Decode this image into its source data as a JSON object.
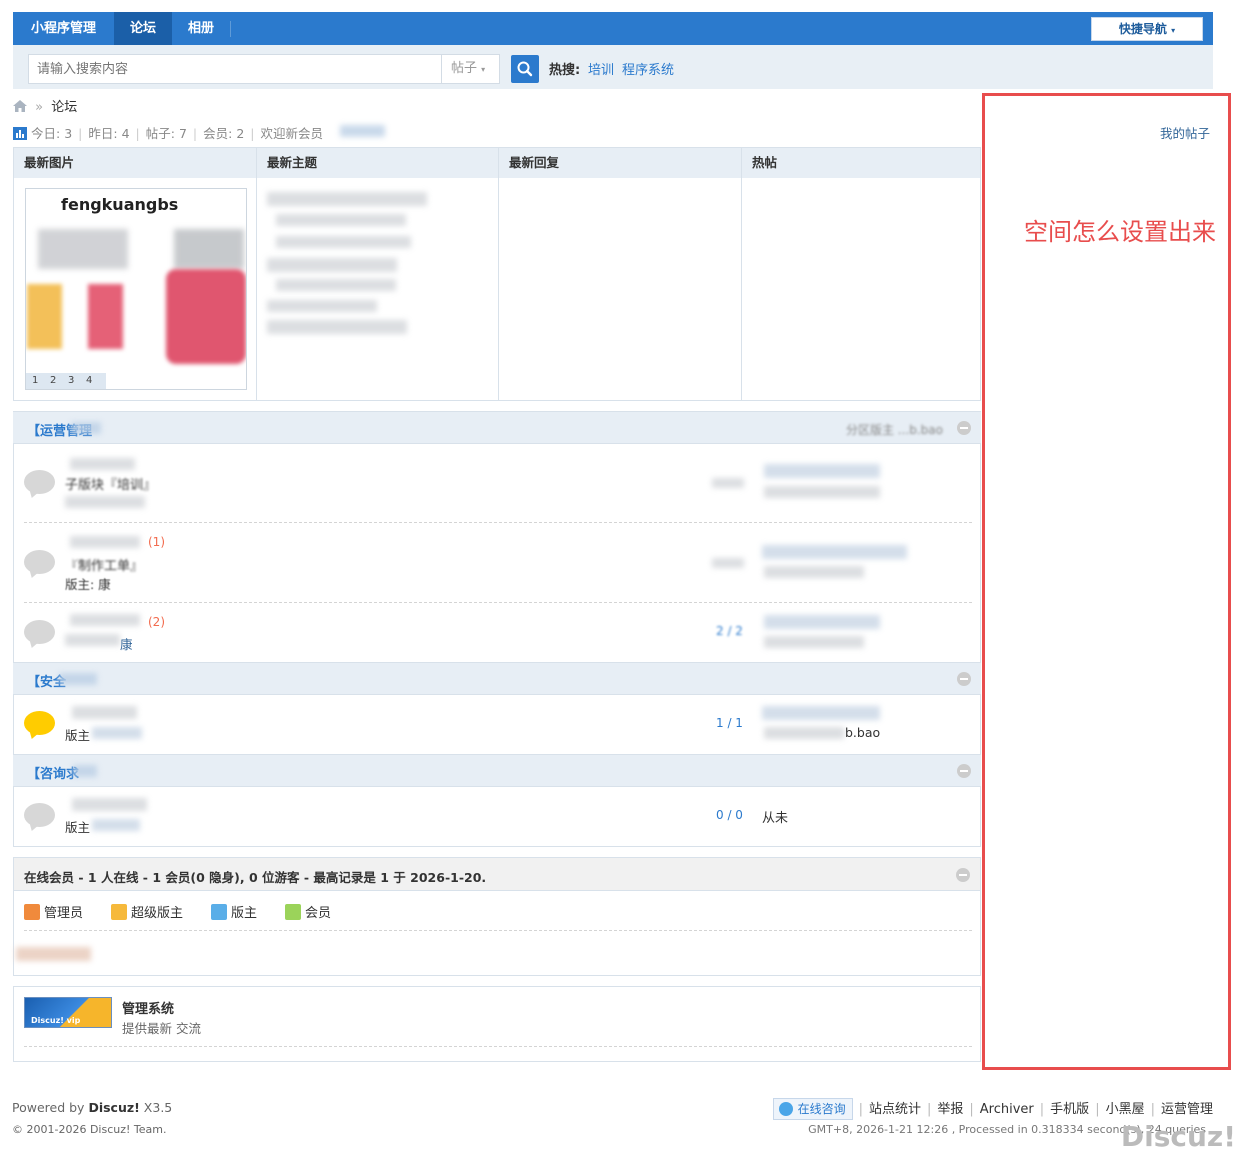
{
  "topnav": {
    "items": [
      "小程序管理",
      "论坛",
      "相册"
    ],
    "active_index": 1,
    "quick_nav": "快捷导航"
  },
  "search": {
    "placeholder": "请输入搜索内容",
    "type": "帖子",
    "hot_label": "热搜:",
    "hot_links": [
      "培训",
      "程序系统"
    ]
  },
  "breadcrumb": {
    "current": "论坛"
  },
  "stats": {
    "today_label": "今日:",
    "today": "3",
    "yesterday_label": "昨日:",
    "yesterday": "4",
    "posts_label": "帖子:",
    "posts": "7",
    "members_label": "会员:",
    "members": "2",
    "welcome_label": "欢迎新会员"
  },
  "highlights": {
    "headers": [
      "最新图片",
      "最新主题",
      "最新回复",
      "热帖"
    ],
    "image_title": "fengkuangbs",
    "slide_pages": [
      "1",
      "2",
      "3",
      "4"
    ]
  },
  "categories": [
    {
      "title": "【运营管理",
      "right_note": "分区版主 ...b.bao"
    },
    {
      "title": "【安全"
    },
    {
      "title": "【咨询求"
    }
  ],
  "forums": {
    "row1_name": "子版块『培训』",
    "row2_name": "『制作工单』",
    "row2_today": "(1)",
    "row2_mod": "版主: 康",
    "row3_today": "(2)",
    "row3_mod": "康",
    "row3_count": "2 / 2",
    "row4_mod": "版主",
    "row4_count": "1 / 1",
    "row4_last": "b.bao",
    "row5_mod": "版主",
    "row5_count": "0 / 0",
    "row5_last": "从未"
  },
  "online": {
    "title": "在线会员 - 1 人在线 - 1 会员(0 隐身), 0 位游客 - 最高记录是 1 于 2026-1-20.",
    "legend": [
      "管理员",
      "超级版主",
      "版主",
      "会员"
    ]
  },
  "links": {
    "logo_text": "Discuz! vip",
    "name": "管理系统",
    "desc": "提供最新 交流"
  },
  "footer": {
    "powered_prefix": "Powered by ",
    "powered_brand": "Discuz!",
    "powered_version": " X3.5",
    "copyright": "© 2001-2026 Discuz! Team.",
    "consult": "在线咨询",
    "links": [
      "站点统计",
      "举报",
      "Archiver",
      "手机版",
      "小黑屋",
      "运营管理"
    ],
    "time": "GMT+8, 2026-1-21 12:26 , Processed in 0.318334 second(s), 24 queries ."
  },
  "annotation": {
    "my_posts": "我的帖子",
    "note": "空间怎么设置出来"
  },
  "watermark": "Discuz!",
  "colors": {
    "nav": "#2b7acd",
    "annot": "#e84d4d"
  }
}
